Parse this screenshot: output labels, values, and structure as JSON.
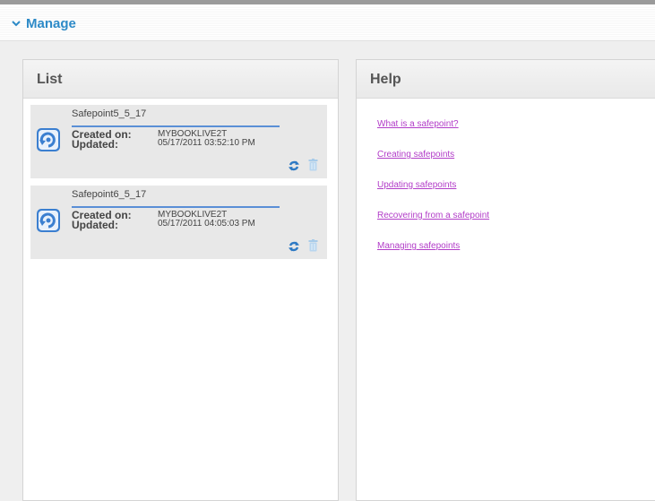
{
  "manage": {
    "title": "Manage"
  },
  "list": {
    "title": "List",
    "created_label": "Created on:",
    "updated_label": "Updated:",
    "safepoints": [
      {
        "name": "Safepoint5_5_17",
        "device": "MYBOOKLIVE2T",
        "updated": "05/17/2011 03:52:10 PM"
      },
      {
        "name": "Safepoint6_5_17",
        "device": "MYBOOKLIVE2T",
        "updated": "05/17/2011 04:05:03 PM"
      }
    ]
  },
  "help": {
    "title": "Help",
    "links": [
      "What is a safepoint?",
      "Creating safepoints",
      "Updating safepoints",
      "Recovering from a safepoint",
      "Managing safepoints"
    ]
  },
  "colors": {
    "accent": "#2d8ac7",
    "link": "#b23cc8",
    "card": "#e8e8e8"
  },
  "icons": {
    "collapse": "chevron-down-icon",
    "safepoint": "safepoint-icon",
    "refresh": "refresh-icon",
    "delete": "trash-icon"
  }
}
